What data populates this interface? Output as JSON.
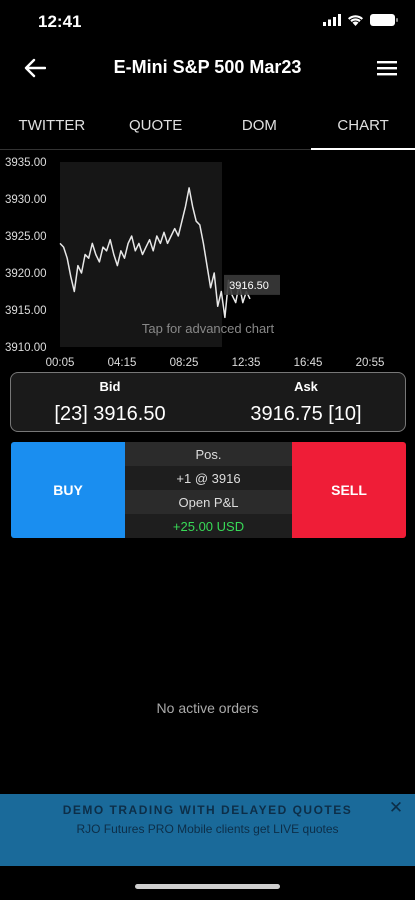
{
  "status_bar": {
    "time": "12:41"
  },
  "nav": {
    "title": "E-Mini S&P 500 Mar23",
    "back_icon": "arrow-left-icon",
    "menu_icon": "hamburger-menu-icon"
  },
  "tabs": [
    {
      "label": "TWITTER",
      "active": false
    },
    {
      "label": "QUOTE",
      "active": false
    },
    {
      "label": "DOM",
      "active": false
    },
    {
      "label": "CHART",
      "active": true
    }
  ],
  "chart_data": {
    "type": "line",
    "title": "",
    "xlabel": "",
    "ylabel": "",
    "x_ticks": [
      "00:05",
      "04:15",
      "08:25",
      "12:35",
      "16:45",
      "20:55"
    ],
    "y_ticks": [
      3935.0,
      3930.0,
      3925.0,
      3920.0,
      3915.0,
      3910.0
    ],
    "y_tick_labels": [
      "3935.00",
      "3930.00",
      "3925.00",
      "3920.00",
      "3915.00",
      "3910.00"
    ],
    "ylim": [
      3910.0,
      3935.0
    ],
    "last_price_label": "3916.50",
    "overlay_text": "Tap for advanced chart",
    "series": [
      {
        "values": [
          3924,
          3923.5,
          3922,
          3919.5,
          3917.5,
          3921,
          3920,
          3922.5,
          3922,
          3924,
          3922.5,
          3921.5,
          3923.5,
          3923,
          3924.5,
          3922.5,
          3921,
          3923,
          3922,
          3924,
          3925,
          3923,
          3924,
          3922.5,
          3923.5,
          3924.5,
          3923,
          3925,
          3924,
          3925.5,
          3924,
          3925,
          3926,
          3925,
          3927,
          3929,
          3931.5,
          3929,
          3927,
          3926.5,
          3924,
          3921,
          3918,
          3920,
          3915.5,
          3917.5,
          3914,
          3919,
          3917,
          3916,
          3918.5,
          3916,
          3917.5,
          3916.5
        ]
      }
    ]
  },
  "quote": {
    "bid_label": "Bid",
    "ask_label": "Ask",
    "bid_value": "[23] 3916.50",
    "ask_value": "3916.75 [10]"
  },
  "trade": {
    "buy_label": "BUY",
    "sell_label": "SELL",
    "pos_label": "Pos.",
    "pos_value": "+1 @ 3916",
    "pnl_label": "Open P&L",
    "pnl_value": "+25.00 USD",
    "colors": {
      "buy": "#1a8ef0",
      "sell": "#ef1d37",
      "pnl": "#38d957"
    }
  },
  "orders": {
    "empty_text": "No active orders"
  },
  "banner": {
    "title": "DEMO TRADING WITH DELAYED QUOTES",
    "subtitle": "RJO Futures PRO Mobile clients get LIVE quotes",
    "close_icon": "close-icon"
  }
}
